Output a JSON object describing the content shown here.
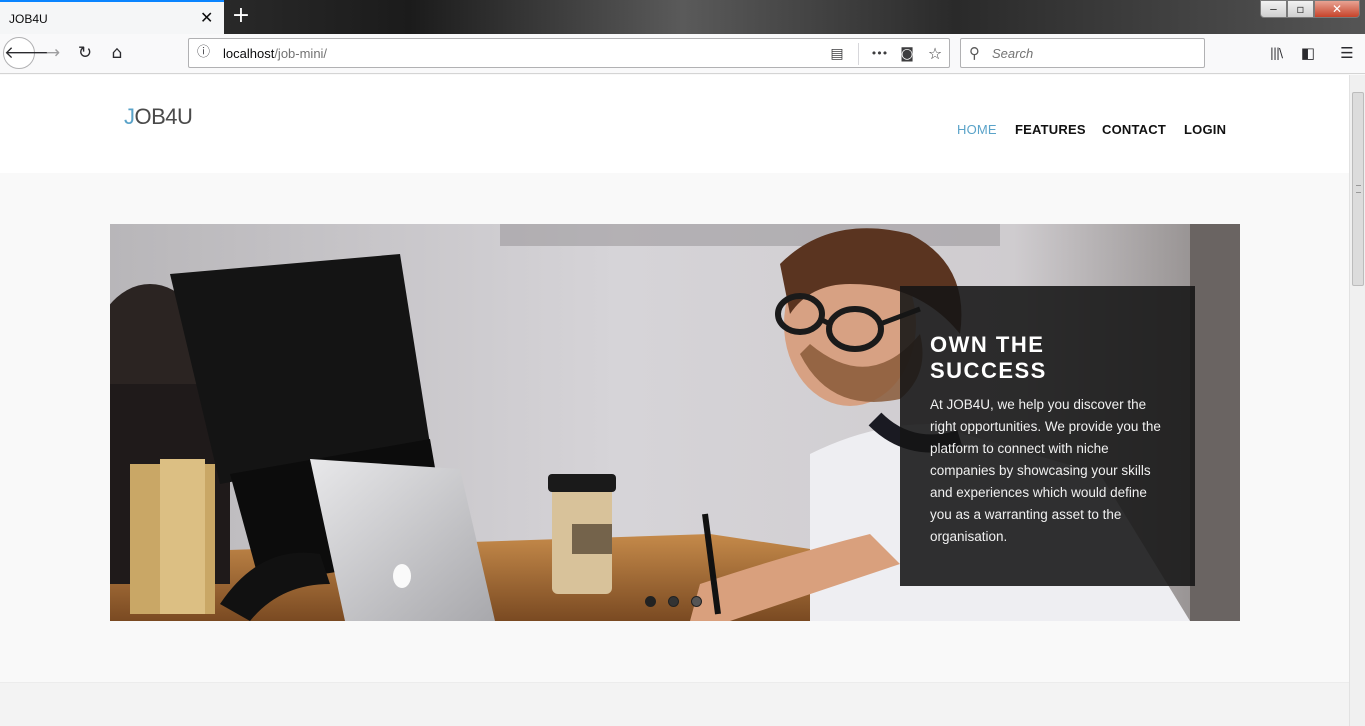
{
  "browser": {
    "tab_title": "JOB4U",
    "tab_close_glyph": "✕",
    "new_tab_glyph": "+",
    "window_min_glyph": "‒",
    "window_max_glyph": "▫",
    "window_close_glyph": "✕",
    "url_host": "localhost",
    "url_path": "/job-mini/",
    "search_placeholder": "Search"
  },
  "nav_icons": {
    "back": "🡐",
    "forward": "→",
    "reload": "↻",
    "home": "⌂",
    "info": "ⓘ",
    "reader": "▤",
    "more": "•••",
    "pocket": "◙",
    "bookmark": "☆",
    "search": "⚲",
    "library": "|||\\",
    "sidebar": "◧",
    "menu": "☰"
  },
  "site": {
    "logo_accent": "J",
    "logo_rest": "OB4U",
    "menu": [
      {
        "label": "HOME",
        "active": true
      },
      {
        "label": "FEATURES",
        "active": false
      },
      {
        "label": "CONTACT",
        "active": false
      },
      {
        "label": "LOGIN",
        "active": false
      }
    ],
    "accent_color": "#5aa3c9"
  },
  "hero": {
    "title": "OWN THE SUCCESS",
    "text": "At JOB4U, we help you discover the right opportunities. We provide you the platform to connect with niche companies by showcasing your skills and experiences which would define you as a warranting asset to the organisation.",
    "slides": 3,
    "active_slide": 1
  }
}
